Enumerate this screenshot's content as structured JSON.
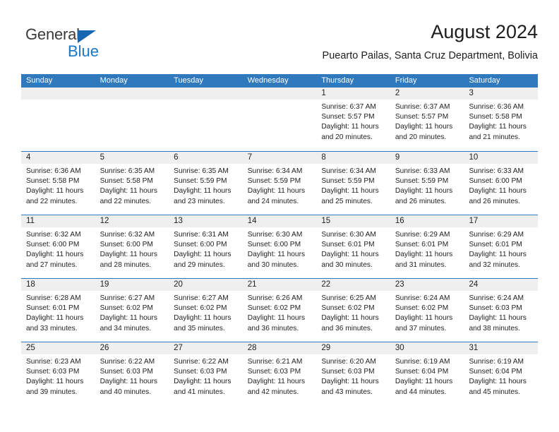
{
  "brand": {
    "name_part1": "General",
    "name_part2": "Blue",
    "triangle_icon": "brand-triangle-icon",
    "colors": {
      "dark": "#3a3a3a",
      "blue": "#1976c8",
      "triangle": "#1565b0"
    }
  },
  "header": {
    "title": "August 2024",
    "subtitle": "Puearto Pailas, Santa Cruz Department, Bolivia"
  },
  "theme": {
    "header_blue": "#3079bd",
    "day_band_gray": "#efefef",
    "text": "#222222"
  },
  "weekdays": [
    "Sunday",
    "Monday",
    "Tuesday",
    "Wednesday",
    "Thursday",
    "Friday",
    "Saturday"
  ],
  "weeks": [
    [
      {
        "empty": true,
        "day": "",
        "lines": []
      },
      {
        "empty": true,
        "day": "",
        "lines": []
      },
      {
        "empty": true,
        "day": "",
        "lines": []
      },
      {
        "empty": true,
        "day": "",
        "lines": []
      },
      {
        "empty": false,
        "day": "1",
        "lines": [
          "Sunrise: 6:37 AM",
          "Sunset: 5:57 PM",
          "Daylight: 11 hours",
          "and 20 minutes."
        ]
      },
      {
        "empty": false,
        "day": "2",
        "lines": [
          "Sunrise: 6:37 AM",
          "Sunset: 5:57 PM",
          "Daylight: 11 hours",
          "and 20 minutes."
        ]
      },
      {
        "empty": false,
        "day": "3",
        "lines": [
          "Sunrise: 6:36 AM",
          "Sunset: 5:58 PM",
          "Daylight: 11 hours",
          "and 21 minutes."
        ]
      }
    ],
    [
      {
        "empty": false,
        "day": "4",
        "lines": [
          "Sunrise: 6:36 AM",
          "Sunset: 5:58 PM",
          "Daylight: 11 hours",
          "and 22 minutes."
        ]
      },
      {
        "empty": false,
        "day": "5",
        "lines": [
          "Sunrise: 6:35 AM",
          "Sunset: 5:58 PM",
          "Daylight: 11 hours",
          "and 22 minutes."
        ]
      },
      {
        "empty": false,
        "day": "6",
        "lines": [
          "Sunrise: 6:35 AM",
          "Sunset: 5:59 PM",
          "Daylight: 11 hours",
          "and 23 minutes."
        ]
      },
      {
        "empty": false,
        "day": "7",
        "lines": [
          "Sunrise: 6:34 AM",
          "Sunset: 5:59 PM",
          "Daylight: 11 hours",
          "and 24 minutes."
        ]
      },
      {
        "empty": false,
        "day": "8",
        "lines": [
          "Sunrise: 6:34 AM",
          "Sunset: 5:59 PM",
          "Daylight: 11 hours",
          "and 25 minutes."
        ]
      },
      {
        "empty": false,
        "day": "9",
        "lines": [
          "Sunrise: 6:33 AM",
          "Sunset: 5:59 PM",
          "Daylight: 11 hours",
          "and 26 minutes."
        ]
      },
      {
        "empty": false,
        "day": "10",
        "lines": [
          "Sunrise: 6:33 AM",
          "Sunset: 6:00 PM",
          "Daylight: 11 hours",
          "and 26 minutes."
        ]
      }
    ],
    [
      {
        "empty": false,
        "day": "11",
        "lines": [
          "Sunrise: 6:32 AM",
          "Sunset: 6:00 PM",
          "Daylight: 11 hours",
          "and 27 minutes."
        ]
      },
      {
        "empty": false,
        "day": "12",
        "lines": [
          "Sunrise: 6:32 AM",
          "Sunset: 6:00 PM",
          "Daylight: 11 hours",
          "and 28 minutes."
        ]
      },
      {
        "empty": false,
        "day": "13",
        "lines": [
          "Sunrise: 6:31 AM",
          "Sunset: 6:00 PM",
          "Daylight: 11 hours",
          "and 29 minutes."
        ]
      },
      {
        "empty": false,
        "day": "14",
        "lines": [
          "Sunrise: 6:30 AM",
          "Sunset: 6:00 PM",
          "Daylight: 11 hours",
          "and 30 minutes."
        ]
      },
      {
        "empty": false,
        "day": "15",
        "lines": [
          "Sunrise: 6:30 AM",
          "Sunset: 6:01 PM",
          "Daylight: 11 hours",
          "and 30 minutes."
        ]
      },
      {
        "empty": false,
        "day": "16",
        "lines": [
          "Sunrise: 6:29 AM",
          "Sunset: 6:01 PM",
          "Daylight: 11 hours",
          "and 31 minutes."
        ]
      },
      {
        "empty": false,
        "day": "17",
        "lines": [
          "Sunrise: 6:29 AM",
          "Sunset: 6:01 PM",
          "Daylight: 11 hours",
          "and 32 minutes."
        ]
      }
    ],
    [
      {
        "empty": false,
        "day": "18",
        "lines": [
          "Sunrise: 6:28 AM",
          "Sunset: 6:01 PM",
          "Daylight: 11 hours",
          "and 33 minutes."
        ]
      },
      {
        "empty": false,
        "day": "19",
        "lines": [
          "Sunrise: 6:27 AM",
          "Sunset: 6:02 PM",
          "Daylight: 11 hours",
          "and 34 minutes."
        ]
      },
      {
        "empty": false,
        "day": "20",
        "lines": [
          "Sunrise: 6:27 AM",
          "Sunset: 6:02 PM",
          "Daylight: 11 hours",
          "and 35 minutes."
        ]
      },
      {
        "empty": false,
        "day": "21",
        "lines": [
          "Sunrise: 6:26 AM",
          "Sunset: 6:02 PM",
          "Daylight: 11 hours",
          "and 36 minutes."
        ]
      },
      {
        "empty": false,
        "day": "22",
        "lines": [
          "Sunrise: 6:25 AM",
          "Sunset: 6:02 PM",
          "Daylight: 11 hours",
          "and 36 minutes."
        ]
      },
      {
        "empty": false,
        "day": "23",
        "lines": [
          "Sunrise: 6:24 AM",
          "Sunset: 6:02 PM",
          "Daylight: 11 hours",
          "and 37 minutes."
        ]
      },
      {
        "empty": false,
        "day": "24",
        "lines": [
          "Sunrise: 6:24 AM",
          "Sunset: 6:03 PM",
          "Daylight: 11 hours",
          "and 38 minutes."
        ]
      }
    ],
    [
      {
        "empty": false,
        "day": "25",
        "lines": [
          "Sunrise: 6:23 AM",
          "Sunset: 6:03 PM",
          "Daylight: 11 hours",
          "and 39 minutes."
        ]
      },
      {
        "empty": false,
        "day": "26",
        "lines": [
          "Sunrise: 6:22 AM",
          "Sunset: 6:03 PM",
          "Daylight: 11 hours",
          "and 40 minutes."
        ]
      },
      {
        "empty": false,
        "day": "27",
        "lines": [
          "Sunrise: 6:22 AM",
          "Sunset: 6:03 PM",
          "Daylight: 11 hours",
          "and 41 minutes."
        ]
      },
      {
        "empty": false,
        "day": "28",
        "lines": [
          "Sunrise: 6:21 AM",
          "Sunset: 6:03 PM",
          "Daylight: 11 hours",
          "and 42 minutes."
        ]
      },
      {
        "empty": false,
        "day": "29",
        "lines": [
          "Sunrise: 6:20 AM",
          "Sunset: 6:03 PM",
          "Daylight: 11 hours",
          "and 43 minutes."
        ]
      },
      {
        "empty": false,
        "day": "30",
        "lines": [
          "Sunrise: 6:19 AM",
          "Sunset: 6:04 PM",
          "Daylight: 11 hours",
          "and 44 minutes."
        ]
      },
      {
        "empty": false,
        "day": "31",
        "lines": [
          "Sunrise: 6:19 AM",
          "Sunset: 6:04 PM",
          "Daylight: 11 hours",
          "and 45 minutes."
        ]
      }
    ]
  ]
}
